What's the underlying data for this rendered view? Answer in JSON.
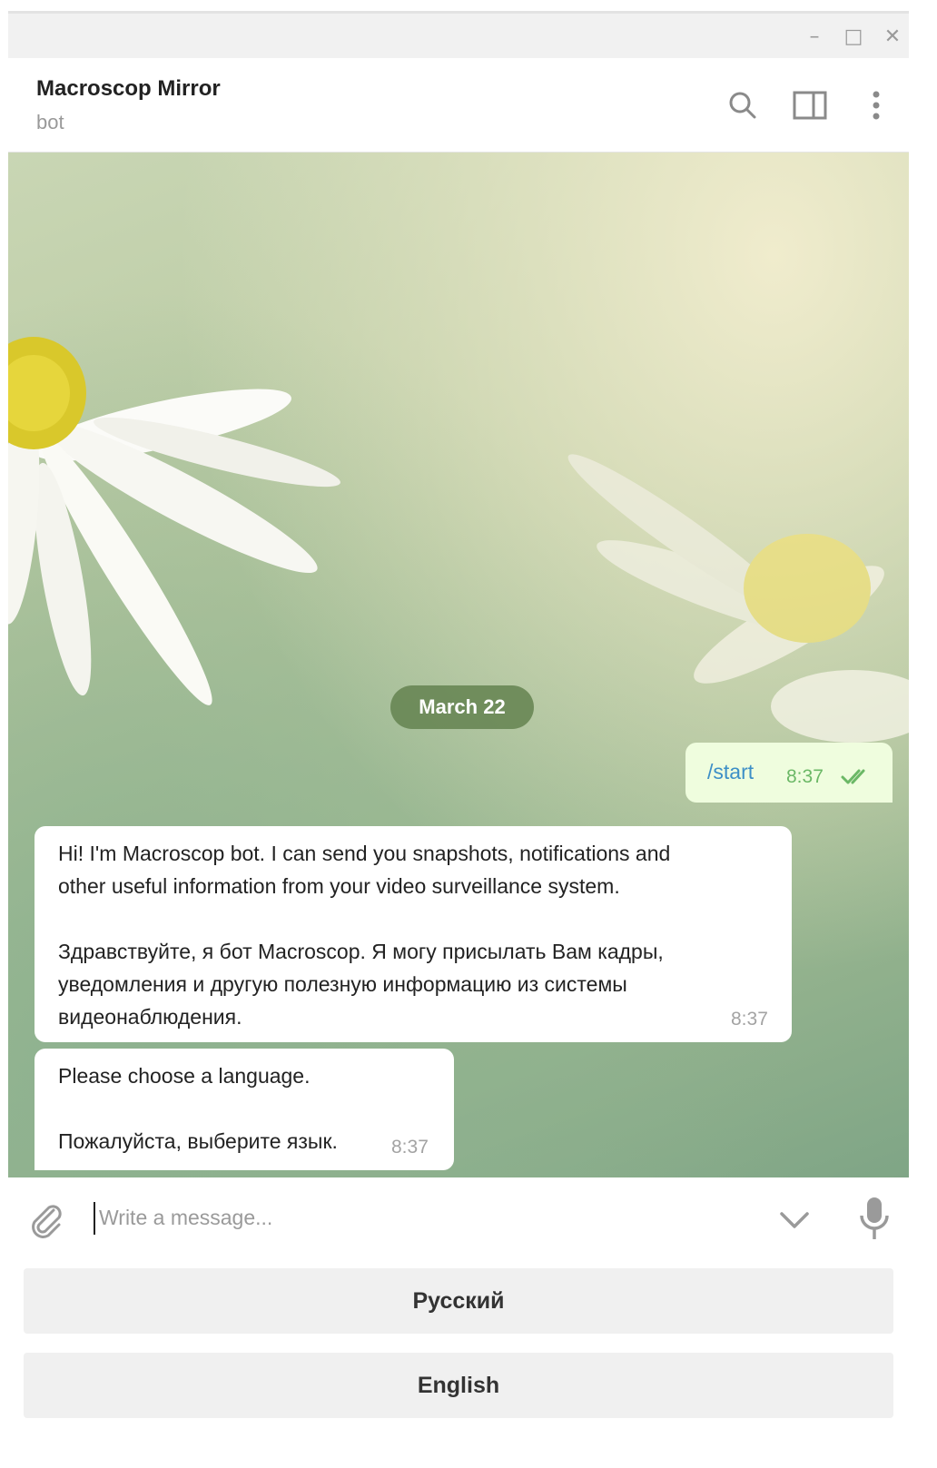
{
  "window": {
    "minimize_glyph": "–",
    "maximize_glyph": "□",
    "close_glyph": "✕"
  },
  "header": {
    "title": "Macroscop Mirror",
    "subtitle": "bot",
    "icons": [
      "search-icon",
      "sidebar-toggle-icon",
      "more-vertical-icon"
    ]
  },
  "chat": {
    "date_label": "March 22",
    "outgoing": {
      "text": "/start",
      "time": "8:37",
      "status": "read"
    },
    "incoming": [
      {
        "lines": [
          "Hi! I'm Macroscop bot. I can send you snapshots, notifications and",
          "other useful information from your video surveillance system.",
          "",
          "Здравствуйте, я бот Macroscop. Я могу присылать Вам кадры,",
          "уведомления и другую полезную информацию из системы",
          "видеонаблюдения."
        ],
        "time": "8:37"
      },
      {
        "lines": [
          "Please choose a language.",
          "",
          "Пожалуйста, выберите язык."
        ],
        "time": "8:37"
      }
    ]
  },
  "composer": {
    "placeholder": "Write a message...",
    "icons": [
      "attach-icon",
      "chevron-down-icon",
      "microphone-icon"
    ]
  },
  "keyboard": {
    "buttons": [
      "Русский",
      "English"
    ]
  },
  "colors": {
    "outgoing_bubble": "#effdde",
    "link": "#3d8fc7",
    "read_check": "#6bb866",
    "date_pill": "#64824f"
  }
}
